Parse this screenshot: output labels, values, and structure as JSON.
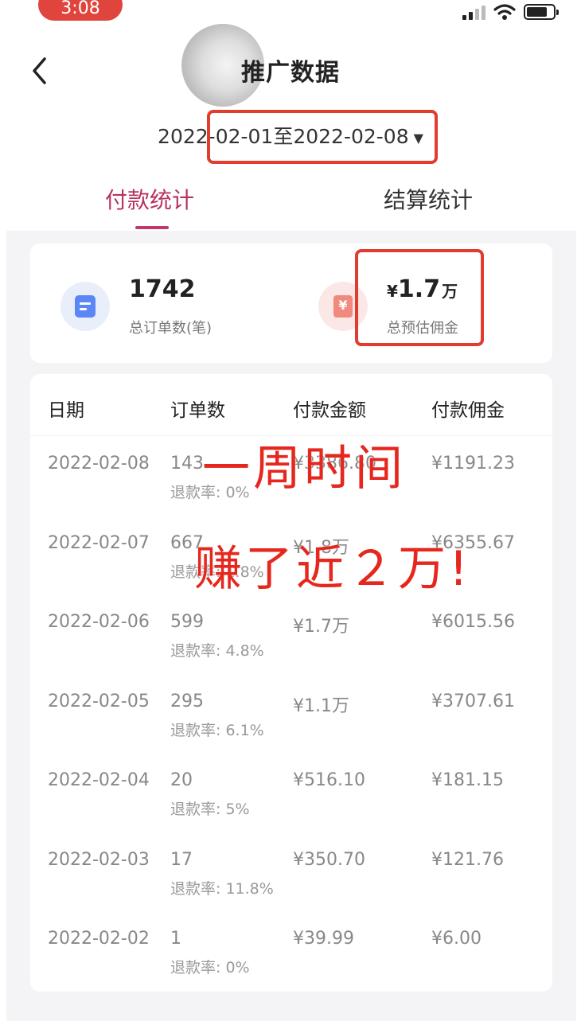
{
  "status_bar": {
    "time": "3:08"
  },
  "header": {
    "title": "推广数据",
    "date_range": "2022-02-01至2022-02-08"
  },
  "tabs": [
    {
      "label": "付款统计",
      "active": true
    },
    {
      "label": "结算统计",
      "active": false
    }
  ],
  "summary": {
    "orders_value": "1742",
    "orders_label": "总订单数(笔)",
    "commission_currency": "¥",
    "commission_value": "1.7",
    "commission_unit": "万",
    "commission_label": "总预估佣金"
  },
  "table": {
    "headers": [
      "日期",
      "订单数",
      "付款金额",
      "付款佣金"
    ],
    "rows": [
      {
        "date": "2022-02-08",
        "count": "143",
        "refund": "退款率: 0%",
        "amount": "¥3386.80",
        "commission": "¥1191.23"
      },
      {
        "date": "2022-02-07",
        "count": "667",
        "refund": "退款率: 1.8%",
        "amount": "¥1.8万",
        "commission": "¥6355.67"
      },
      {
        "date": "2022-02-06",
        "count": "599",
        "refund": "退款率: 4.8%",
        "amount": "¥1.7万",
        "commission": "¥6015.56"
      },
      {
        "date": "2022-02-05",
        "count": "295",
        "refund": "退款率: 6.1%",
        "amount": "¥1.1万",
        "commission": "¥3707.61"
      },
      {
        "date": "2022-02-04",
        "count": "20",
        "refund": "退款率: 5%",
        "amount": "¥516.10",
        "commission": "¥181.15"
      },
      {
        "date": "2022-02-03",
        "count": "17",
        "refund": "退款率: 11.8%",
        "amount": "¥350.70",
        "commission": "¥121.76"
      },
      {
        "date": "2022-02-02",
        "count": "1",
        "refund": "退款率: 0%",
        "amount": "¥39.99",
        "commission": "¥6.00"
      }
    ]
  },
  "annotations": {
    "line1": "一周时间",
    "line2": "赚了近２万!"
  },
  "colors": {
    "accent": "#b8325f",
    "highlight_red": "#e23b2f"
  }
}
